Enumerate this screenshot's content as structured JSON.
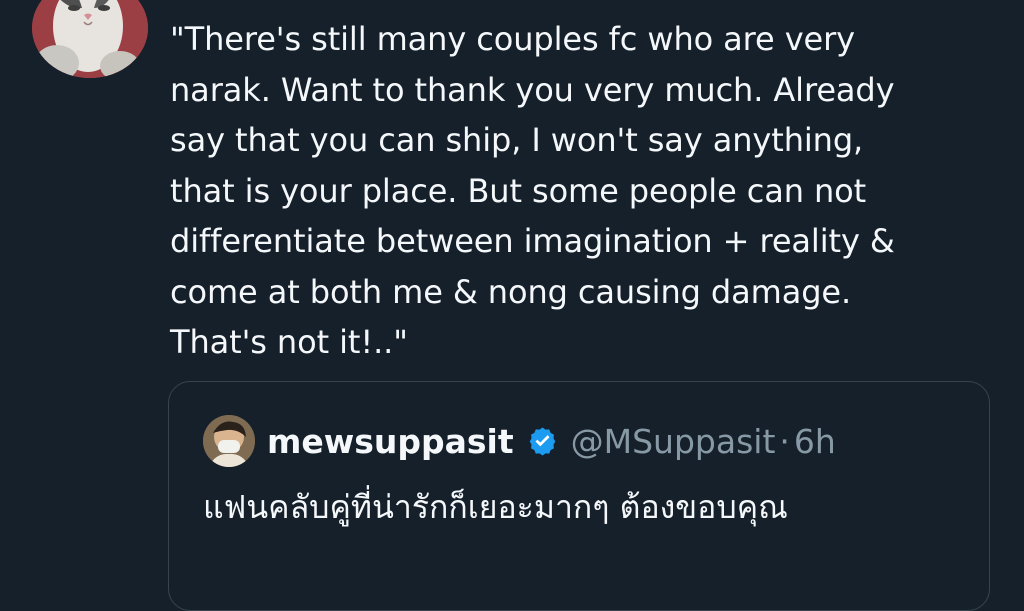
{
  "tweet": {
    "text_lines": [
      "\"There's still many couples fc who are very",
      "narak. Want to thank you very much. Already",
      "say that you can ship, I won't say anything,",
      "that is your place. But some people can not",
      "differentiate between imagination + reality &",
      "come at both me & nong causing damage.",
      "That's not it!..\""
    ]
  },
  "quoted_tweet": {
    "display_name": "mewsuppasit",
    "handle": "@MSuppasit",
    "separator": "·",
    "time": "6h",
    "text_line_1": "แฟนคลับคู่ที่น่ารักก็เยอะมากๆ ต้องขอบคุณ",
    "verified_icon": "verified-badge-icon"
  },
  "colors": {
    "background": "#15202b",
    "text": "#f5f8fa",
    "secondary_text": "#8899a6",
    "border": "#38444d",
    "verified": "#1d9bf0"
  }
}
